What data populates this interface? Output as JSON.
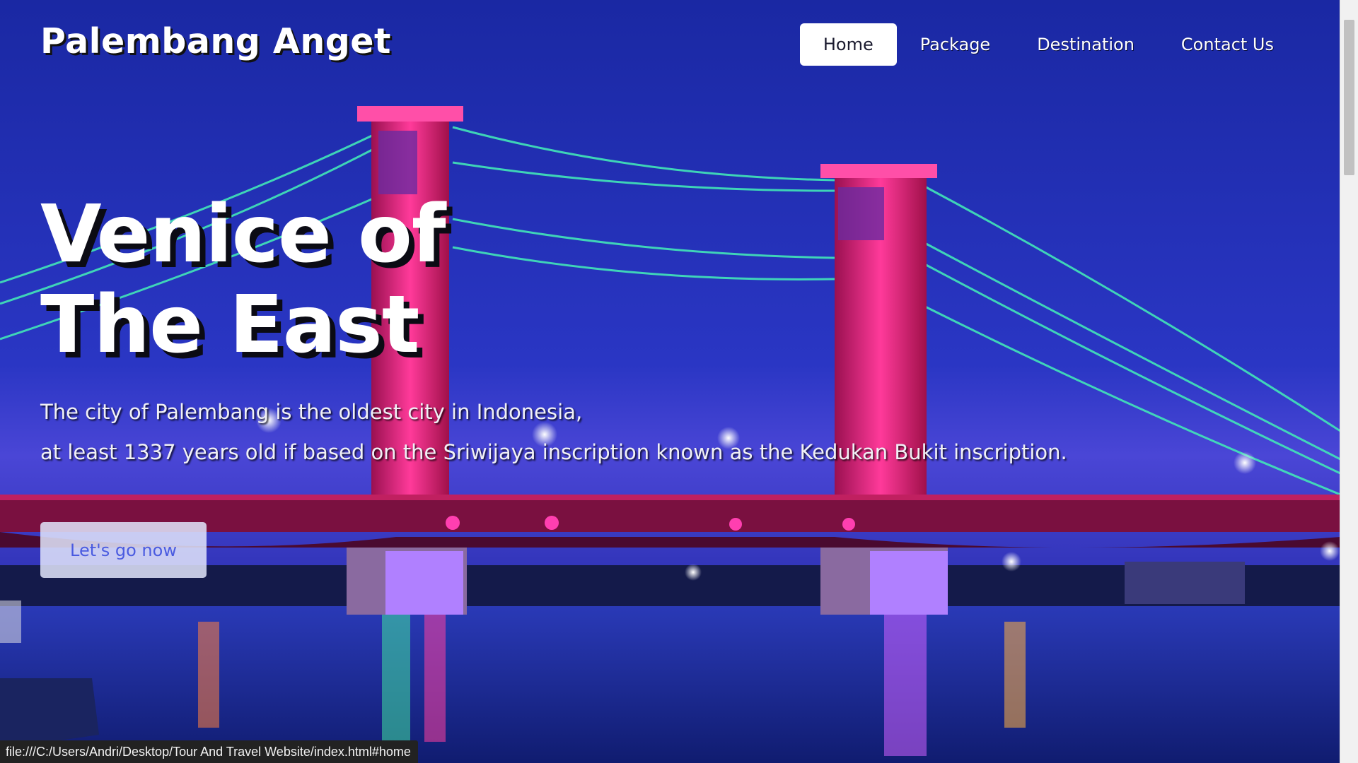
{
  "header": {
    "brand": "Palembang Anget",
    "nav": [
      {
        "label": "Home",
        "active": true
      },
      {
        "label": "Package",
        "active": false
      },
      {
        "label": "Destination",
        "active": false
      },
      {
        "label": "Contact Us",
        "active": false
      }
    ]
  },
  "hero": {
    "title_line1": "Venice of",
    "title_line2": "The East",
    "description_line1": "The city of Palembang is the oldest city in Indonesia,",
    "description_line2": "at least 1337 years old if based on the Sriwijaya inscription known as the Kedukan Bukit inscription.",
    "cta_label": "Let's go now"
  },
  "status_bar": {
    "url": "file:///C:/Users/Andri/Desktop/Tour And Travel Website/index.html#home"
  },
  "colors": {
    "sky_top": "#1a2aa8",
    "sky_bottom": "#3a3fd0",
    "tower_pink": "#e0206e",
    "cable_green": "#3fe0b0",
    "water": "#1c2d9a",
    "nav_active_bg": "#ffffff",
    "cta_text": "#4a5be0"
  },
  "background_image": {
    "icon": "bridge-night-photo"
  }
}
